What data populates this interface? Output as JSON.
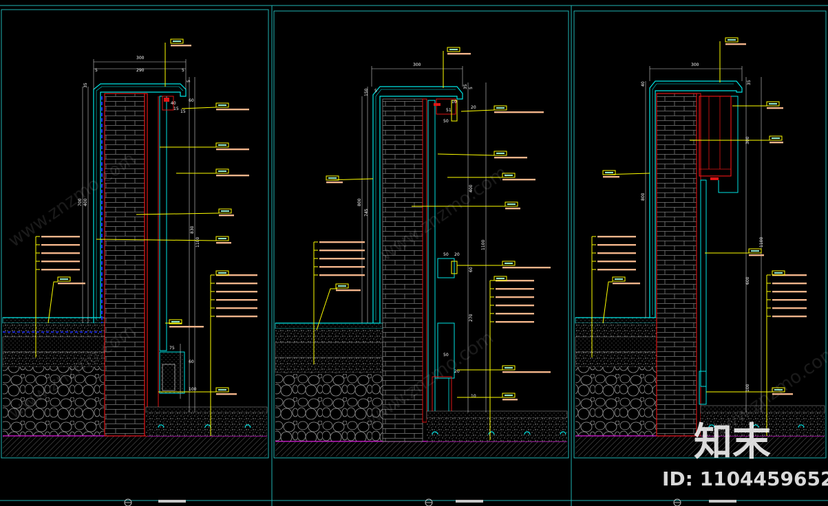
{
  "colors": {
    "background": "#000000",
    "frame": "#1fb5b5",
    "brick": "#9a9a9a",
    "red": "#e01515",
    "blue": "#1a2bff",
    "yellow_leader": "#ffff00",
    "cyan": "#00e5e5",
    "label_fill": "#f2b48a",
    "magenta": "#e020e0",
    "ground_hatch": "#8a8a8a"
  },
  "watermark": {
    "logo_text": "知末",
    "id_text": "ID: 1104459652",
    "url_text": "www.znzmo.com"
  },
  "sections": [
    {
      "name": "section-left",
      "dims": [
        "300",
        "5",
        "290",
        "5",
        "35",
        "5",
        "15",
        "40",
        "60",
        "15",
        "400",
        "700",
        "830",
        "1100",
        "75",
        "60",
        "100"
      ]
    },
    {
      "name": "section-middle",
      "dims": [
        "300",
        "150",
        "5",
        "35",
        "5",
        "10",
        "51",
        "50",
        "20",
        "800",
        "745",
        "1100",
        "400",
        "50",
        "20",
        "60",
        "270",
        "50",
        "20",
        "10"
      ]
    },
    {
      "name": "section-right",
      "dims": [
        "300",
        "40",
        "35",
        "300",
        "800",
        "1100",
        "600",
        "100"
      ]
    }
  ]
}
